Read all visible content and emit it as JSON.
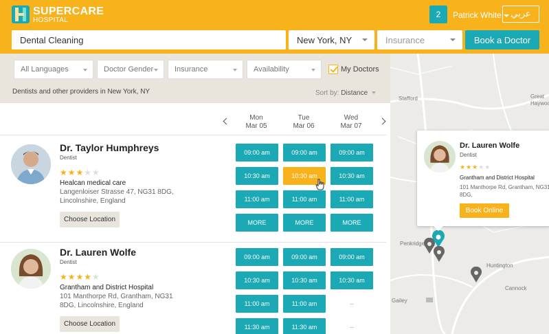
{
  "header": {
    "brand_name": "SUPERCARE",
    "brand_sub": "HOSPITAL",
    "notifications": "2",
    "user_name": "Patrick White",
    "language_button": "عربي"
  },
  "search": {
    "procedure": "Dental Cleaning",
    "location": "New York, NY",
    "insurance_placeholder": "Insurance",
    "book_button": "Book a Doctor"
  },
  "filters": {
    "languages": "All Languages",
    "gender": "Doctor Gender",
    "insurance": "Insurance",
    "availability": "Availability",
    "my_doctors_label": "My Doctors",
    "my_doctors_checked": true
  },
  "results": {
    "summary": "Dentists and other providers in New York, NY",
    "sort_label": "Sort by:",
    "sort_value": "Distance"
  },
  "days": [
    {
      "day": "Mon",
      "date": "Mar 05"
    },
    {
      "day": "Tue",
      "date": "Mar 06"
    },
    {
      "day": "Wed",
      "date": "Mar 07"
    }
  ],
  "doctors": [
    {
      "name": "Dr. Taylor Humphreys",
      "specialty": "Dentist",
      "rating": 3,
      "clinic": "Healcan medical care",
      "address": "Langenloiser Strasse 47, NG31 8DG, Lincolnshire, England",
      "choose_location": "Choose Location",
      "slots": [
        [
          "09:00 am",
          "09:00 am",
          "09:00 am"
        ],
        [
          "10:30 am",
          "10:30 am",
          "10:30 am"
        ],
        [
          "11:00 am",
          "11:00 am",
          "11:00 am"
        ],
        [
          "MORE",
          "MORE",
          "MORE"
        ]
      ]
    },
    {
      "name": "Dr. Lauren Wolfe",
      "specialty": "Dentist",
      "rating": 4,
      "clinic": "Grantham and District Hospital",
      "address": "101 Manthorpe Rd, Grantham, NG31 8DG, Lincolnshire, England",
      "choose_location": "Choose Location",
      "slots": [
        [
          "09:00 am",
          "09:00 am",
          "09:00 am"
        ],
        [
          "10:30 am",
          "10:30 am",
          "10:30 am"
        ],
        [
          "11:00 am",
          "11:00 am",
          "--"
        ],
        [
          "11:30 am",
          "11:30 am",
          "--"
        ]
      ]
    }
  ],
  "map": {
    "labels": [
      "Stafford",
      "Great Haywood",
      "Penkridge",
      "Huntington",
      "Cannock",
      "Gailey"
    ],
    "popup": {
      "name": "Dr. Lauren Wolfe",
      "specialty": "Dentist",
      "rating": 3,
      "clinic": "Grantham and District Hospital",
      "address": "101 Manthorpe Rd, Grantham, NG31 8DG,",
      "button": "Book Online"
    }
  },
  "colors": {
    "accent": "#f7b21c",
    "primary": "#1aa9b5"
  }
}
